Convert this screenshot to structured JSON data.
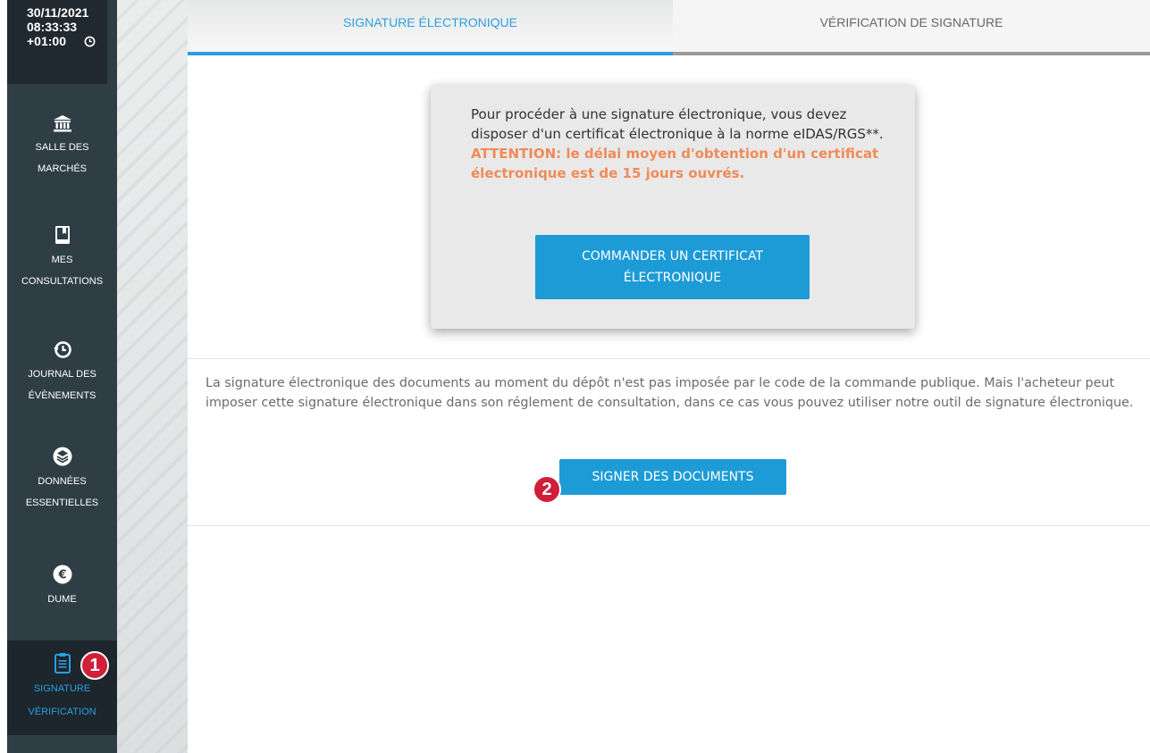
{
  "sidebar": {
    "clock": {
      "date": "30/11/2021",
      "time": "08:33:33",
      "tz": "+01:00",
      "icon": "clock-icon"
    },
    "items": [
      {
        "icon": "bank-icon",
        "lines": [
          "SALLE DES",
          "MARCHÉS"
        ],
        "active": false
      },
      {
        "icon": "bookmark-book-icon",
        "lines": [
          "MES",
          "CONSULTATIONS"
        ],
        "active": false
      },
      {
        "icon": "history-icon",
        "lines": [
          "JOURNAL DES",
          "ÉVÈNEMENTS"
        ],
        "active": false
      },
      {
        "icon": "database-stack-icon",
        "lines": [
          "DONNÉES",
          "ESSENTIELLES"
        ],
        "active": false
      },
      {
        "icon": "euro-icon",
        "lines": [
          "DUME"
        ],
        "active": false
      },
      {
        "icon": "clipboard-icon",
        "lines": [
          "SIGNATURE",
          "VÉRIFICATION"
        ],
        "active": true
      }
    ]
  },
  "tabs": [
    {
      "label": "SIGNATURE ÉLECTRONIQUE",
      "active": true
    },
    {
      "label": "VÉRIFICATION DE SIGNATURE",
      "active": false
    }
  ],
  "card": {
    "intro": "Pour procéder à une signature électronique, vous devez disposer d'un certificat électronique à la norme eIDAS/RGS**.",
    "warning": "ATTENTION: le délai moyen d'obtention d'un certificat électronique est de 15 jours ouvrés.",
    "button": "COMMANDER UN CERTIFICAT ÉLECTRONIQUE"
  },
  "description": "La signature électronique des documents au moment du dépôt n'est pas imposée par le code de la commande publique. Mais l'acheteur peut imposer cette signature électronique dans son réglement de consultation, dans ce cas vous pouvez utiliser notre outil de signature électronique.",
  "sign_button": "SIGNER DES DOCUMENTS",
  "annotations": {
    "badge1": "1",
    "badge2": "2"
  },
  "colors": {
    "accent": "#2a9fe0",
    "button": "#1d9bd7",
    "warning": "#f08b59",
    "sidebar": "#2f3d45",
    "badge": "#cf1f3a"
  }
}
